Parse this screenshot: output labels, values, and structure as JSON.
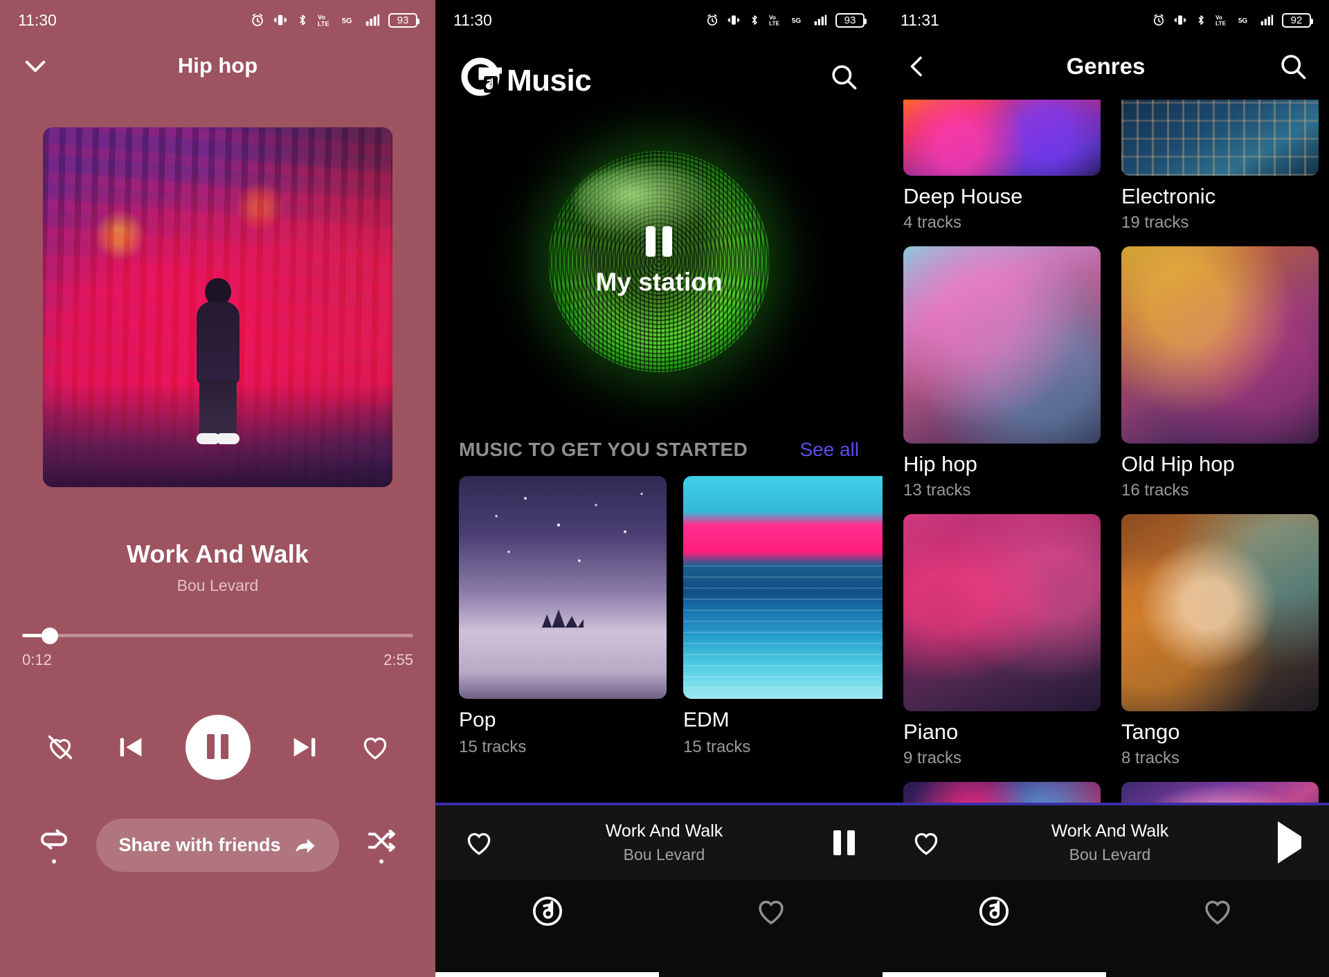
{
  "panel_player": {
    "status": {
      "time": "11:30",
      "battery": "93",
      "icons": [
        "alarm-icon",
        "vibrate-icon",
        "bluetooth-icon",
        "volte-icon",
        "signal-5g-icon",
        "signal-bars-icon"
      ]
    },
    "collapse_icon": "chevron-down-icon",
    "title": "Hip hop",
    "album_art_alt": "hip-hop-street-artwork",
    "track": {
      "title": "Work And Walk",
      "artist": "Bou Levard"
    },
    "progress": {
      "current": "0:12",
      "total": "2:55",
      "percent": 7
    },
    "controls": {
      "dislike_icon": "heart-broken-icon",
      "previous_icon": "skip-previous-icon",
      "pause_icon": "pause-icon",
      "next_icon": "skip-next-icon",
      "like_icon": "heart-outline-icon",
      "repeat_icon": "repeat-one-icon",
      "shuffle_icon": "shuffle-icon"
    },
    "share_label": "Share with friends",
    "share_icon": "share-arrow-icon",
    "accent": "#9d5360"
  },
  "panel_home": {
    "status": {
      "time": "11:30",
      "battery": "93"
    },
    "brand": {
      "logo_icon": "g-music-logo-icon",
      "name": "Music"
    },
    "search_icon": "search-icon",
    "station": {
      "label": "My station",
      "state_icon": "pause-icon",
      "sphere_color": "#4ee02b"
    },
    "section": {
      "title": "MUSIC TO GET YOU STARTED",
      "see_all": "See all",
      "see_all_color": "#5b4ee8"
    },
    "cards": [
      {
        "name": "Pop",
        "tracks": "15 tracks",
        "art": "night-sky-city-art"
      },
      {
        "name": "EDM",
        "tracks": "15 tracks",
        "art": "pink-sunset-ocean-art"
      }
    ],
    "mini": {
      "like_icon": "heart-outline-icon",
      "title": "Work And Walk",
      "artist": "Bou Levard",
      "action_icon": "pause-icon"
    },
    "nav": [
      {
        "icon": "music-note-circle-icon",
        "name": "library",
        "active": true
      },
      {
        "icon": "heart-outline-icon",
        "name": "favorites",
        "active": false
      }
    ]
  },
  "panel_genres": {
    "status": {
      "time": "11:31",
      "battery": "92"
    },
    "back_icon": "chevron-left-icon",
    "title": "Genres",
    "search_icon": "search-icon",
    "genres": [
      {
        "name": "Deep House",
        "tracks": "4 tracks",
        "art": "deep-house-art",
        "clipped_top": true
      },
      {
        "name": "Electronic",
        "tracks": "19 tracks",
        "art": "electronic-art",
        "clipped_top": true
      },
      {
        "name": "Hip hop",
        "tracks": "13 tracks",
        "art": "hip-hop-art"
      },
      {
        "name": "Old Hip hop",
        "tracks": "16 tracks",
        "art": "old-hip-hop-art"
      },
      {
        "name": "Piano",
        "tracks": "9 tracks",
        "art": "piano-art"
      },
      {
        "name": "Tango",
        "tracks": "8 tracks",
        "art": "tango-art"
      },
      {
        "name": "",
        "tracks": "",
        "art": "neon-art",
        "clipped_bottom": true
      },
      {
        "name": "",
        "tracks": "",
        "art": "face-art",
        "clipped_bottom": true
      }
    ],
    "mini": {
      "like_icon": "heart-outline-icon",
      "title": "Work And Walk",
      "artist": "Bou Levard",
      "action_icon": "play-icon"
    },
    "nav": [
      {
        "icon": "music-note-circle-icon",
        "name": "library",
        "active": true
      },
      {
        "icon": "heart-outline-icon",
        "name": "favorites",
        "active": false
      }
    ]
  }
}
